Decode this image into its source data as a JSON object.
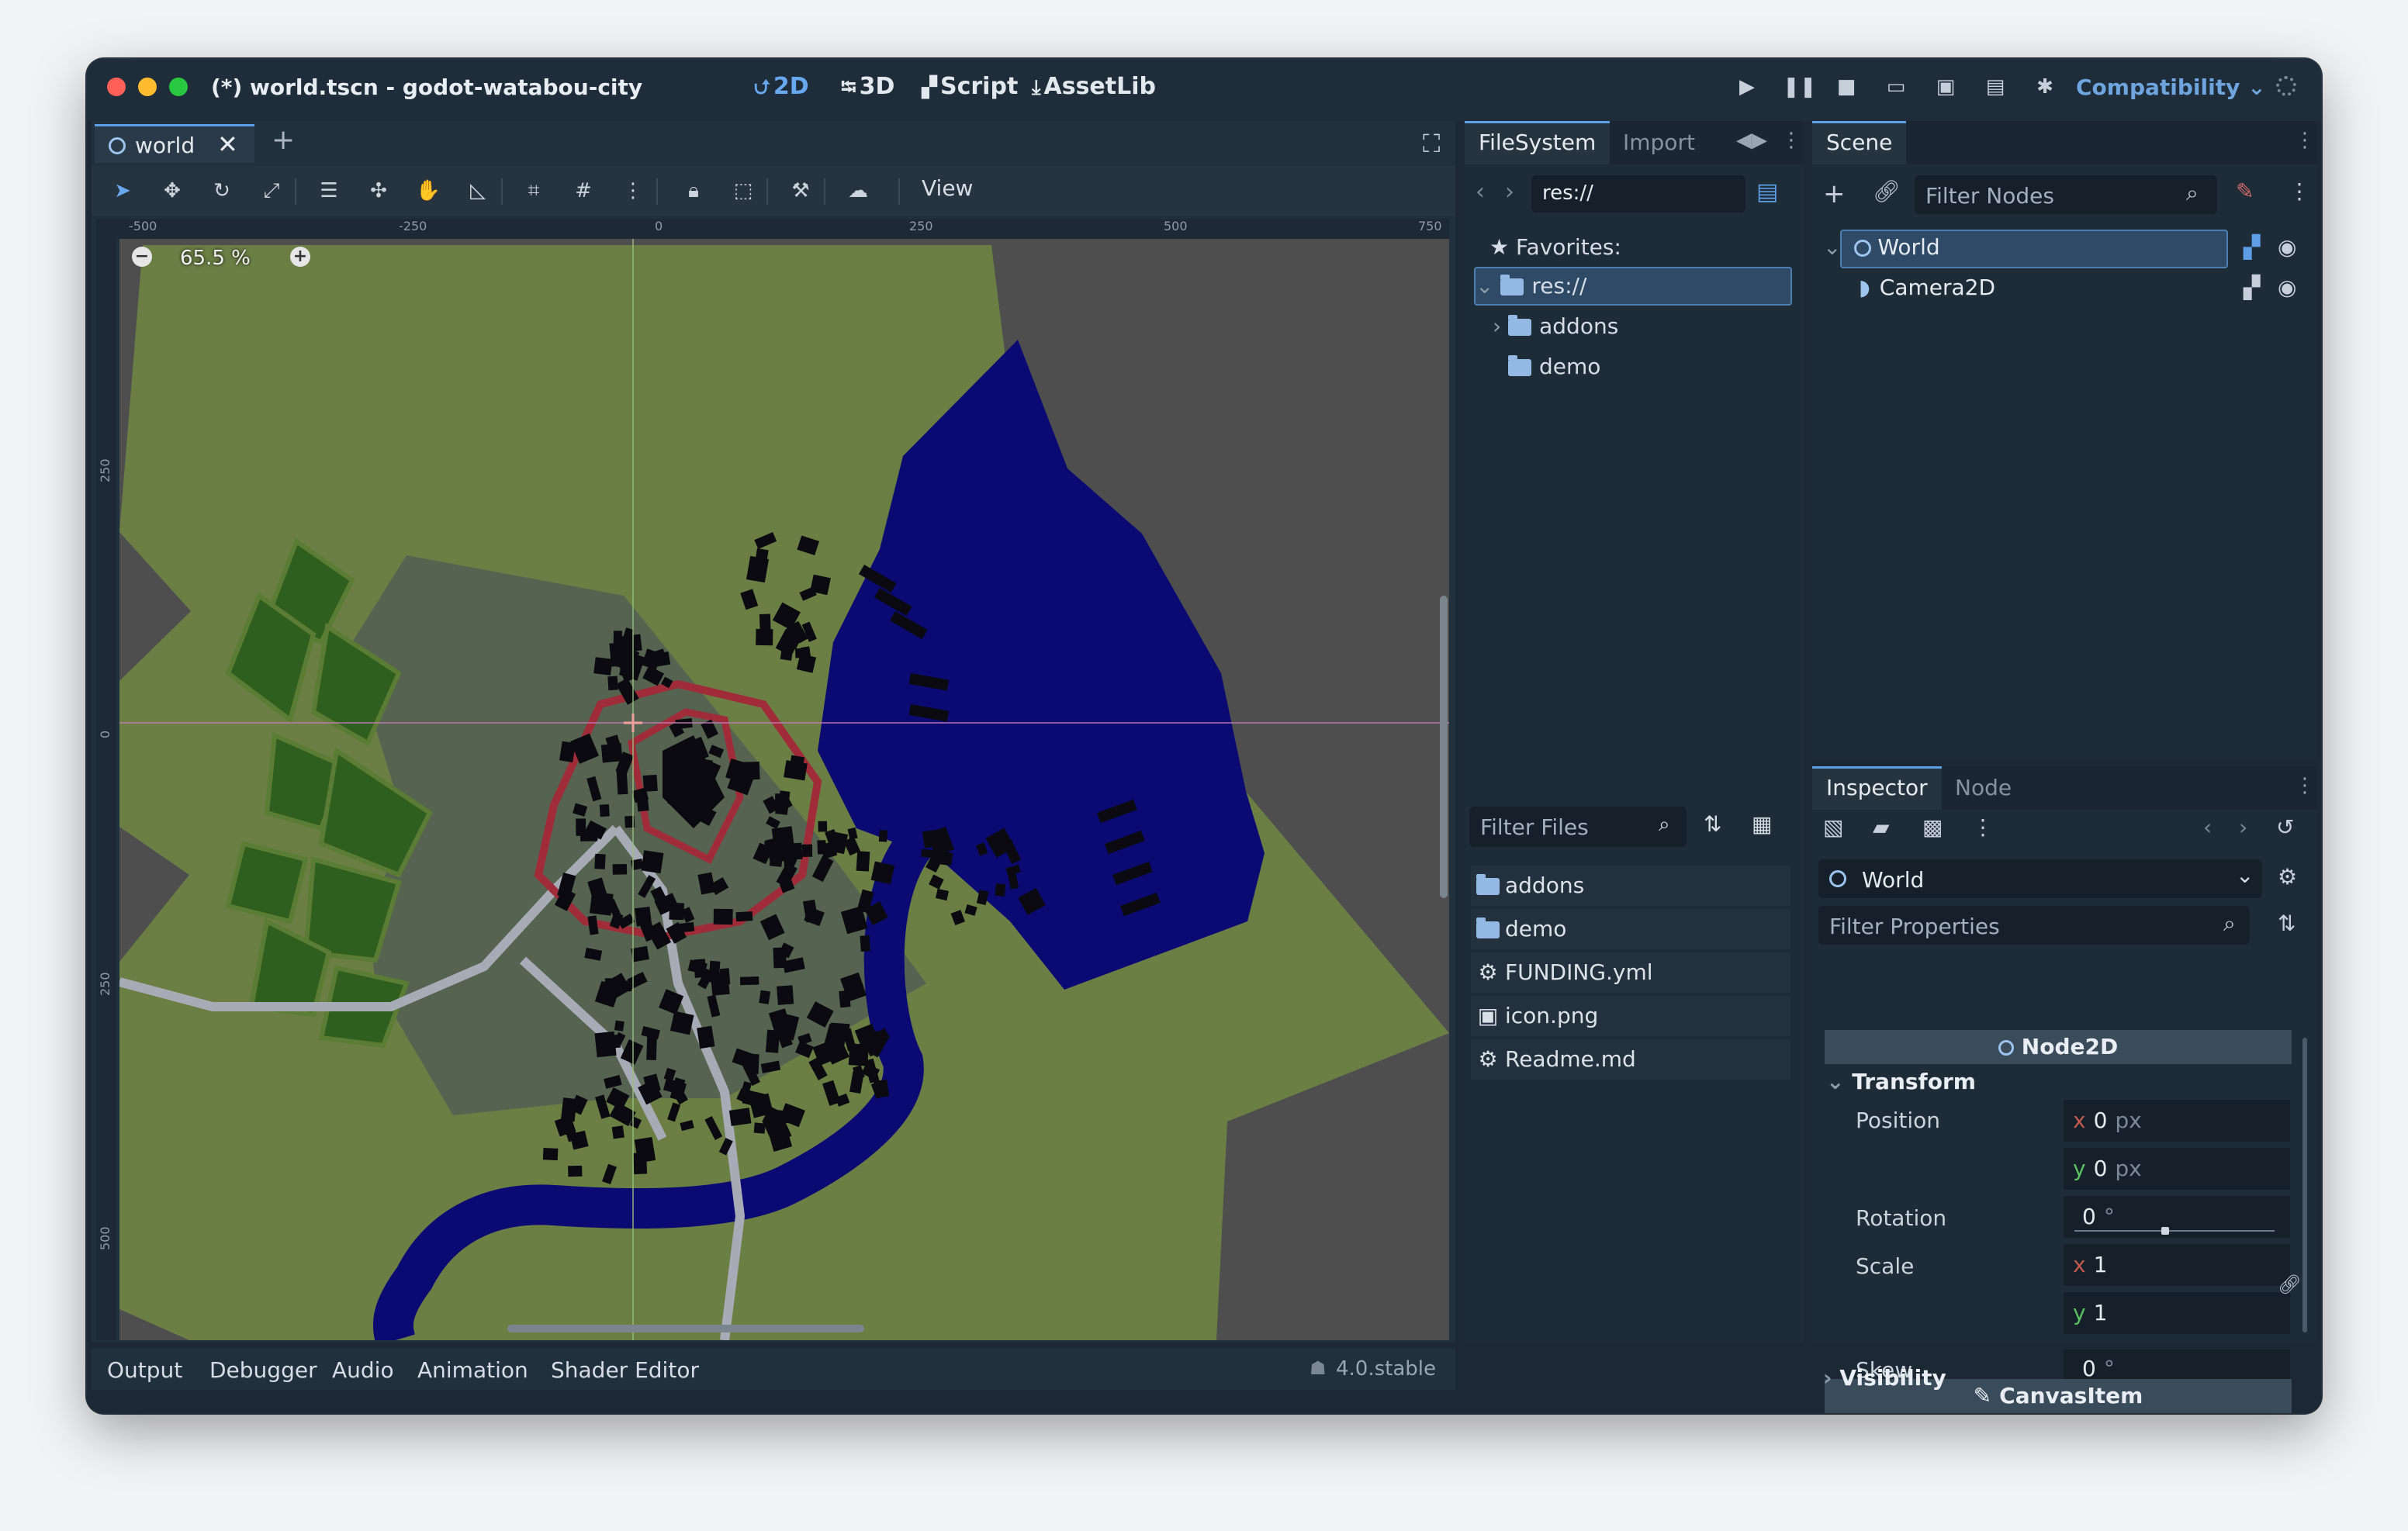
{
  "window": {
    "title": "(*) world.tscn - godot-watabou-city",
    "modes": [
      {
        "label": "2D",
        "glyph": "⮍"
      },
      {
        "label": "3D",
        "glyph": "⭾"
      },
      {
        "label": "Script",
        "glyph": "▞"
      },
      {
        "label": "AssetLib",
        "glyph": "⤓"
      }
    ],
    "renderer": "Compatibility"
  },
  "editor": {
    "scene_tab": "world",
    "zoom": "65.5 %",
    "view_menu": "View",
    "ruler_top": [
      "-500",
      "-250",
      "0",
      "250",
      "500",
      "750"
    ],
    "ruler_left": [
      "250",
      "0",
      "250",
      "500"
    ]
  },
  "bottom_panel": {
    "tabs": [
      "Output",
      "Debugger",
      "Audio",
      "Animation",
      "Shader Editor"
    ],
    "version": "4.0.stable"
  },
  "filesystem": {
    "tabs": [
      "FileSystem",
      "Import"
    ],
    "path": "res://",
    "favorites": "Favorites:",
    "tree": [
      {
        "label": "res://"
      },
      {
        "label": "addons"
      },
      {
        "label": "demo"
      }
    ],
    "filter_placeholder": "Filter Files",
    "files": [
      {
        "name": "addons",
        "icon": "folder-icon"
      },
      {
        "name": "demo",
        "icon": "folder-icon"
      },
      {
        "name": "FUNDING.yml",
        "icon": "gear-icon"
      },
      {
        "name": "icon.png",
        "icon": "image-icon"
      },
      {
        "name": "Readme.md",
        "icon": "gear-icon"
      }
    ]
  },
  "scene": {
    "tab": "Scene",
    "filter_placeholder": "Filter Nodes",
    "nodes": [
      {
        "name": "World",
        "icon": "node2d-icon"
      },
      {
        "name": "Camera2D",
        "icon": "camera-icon"
      }
    ]
  },
  "inspector": {
    "tabs": [
      "Inspector",
      "Node"
    ],
    "object": "World",
    "filter_placeholder": "Filter Properties",
    "class_header": "Node2D",
    "transform_section": "Transform",
    "position_label": "Position",
    "position": {
      "x": "0",
      "y": "0",
      "unit": "px"
    },
    "rotation_label": "Rotation",
    "rotation": "0",
    "degree_unit": "°",
    "scale_label": "Scale",
    "scale": {
      "x": "1",
      "y": "1"
    },
    "skew_label": "Skew",
    "skew": "0",
    "canvasitem_header": "CanvasItem",
    "visibility_section": "Visibility"
  },
  "colors": {
    "accent": "#5d9ee6",
    "terrain": "#6b7f45",
    "water": "#0b0a73",
    "district": "#556350",
    "wall": "#a02c3a",
    "parks": "#2f5f1e"
  }
}
